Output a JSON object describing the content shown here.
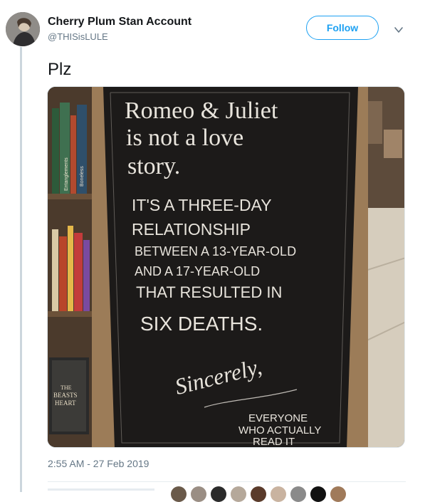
{
  "tweet": {
    "display_name": "Cherry Plum Stan Account",
    "handle": "@THISisLULE",
    "follow_label": "Follow",
    "text": "Plz",
    "timestamp": "2:55 AM - 27 Feb 2019"
  },
  "chalkboard": {
    "line1": "Romeo & Juliet",
    "line2": "is not a love",
    "line3": "story.",
    "line4": "IT'S A THREE-DAY",
    "line5": "RELATIONSHIP",
    "line6": "BETWEEN A 13-YEAR-OLD",
    "line7": "AND A 17-YEAR-OLD",
    "line8": "THAT RESULTED IN",
    "line9": "SIX DEATHS.",
    "line10": "Sincerely,",
    "line11": "EVERYONE",
    "line12": "WHO ACTUALLY",
    "line13": "READ IT"
  },
  "book_spines": {
    "spine1": "Boneless",
    "spine2": "Entanglements",
    "book_title_1": "THE",
    "book_title_2": "BEASTS",
    "book_title_3": "HEART"
  },
  "colors": {
    "accent": "#1da1f2",
    "secondary_text": "#657786",
    "chalk": "#e8e4dc",
    "board": "#1c1a19",
    "frame": "#9c7c58"
  },
  "icons": {
    "caret": "chevron-down-icon"
  }
}
